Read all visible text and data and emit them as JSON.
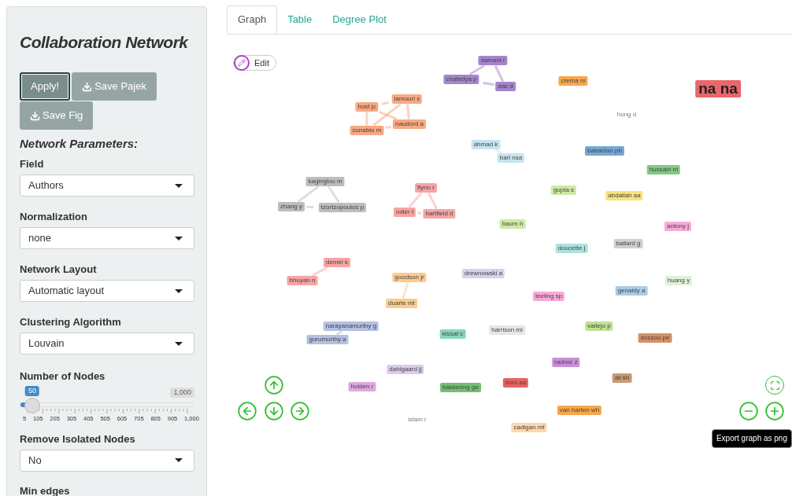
{
  "sidebar": {
    "title": "Collaboration Network",
    "buttons": [
      {
        "label": "Apply!",
        "kind": "primary"
      },
      {
        "label": "Save Pajek",
        "kind": "download"
      },
      {
        "label": "Save Fig",
        "kind": "download"
      }
    ],
    "section_title": "Network Parameters:",
    "controls": [
      {
        "kind": "select",
        "label": "Field",
        "value": "Authors"
      },
      {
        "kind": "select",
        "label": "Normalization",
        "value": "none"
      },
      {
        "kind": "select",
        "label": "Network Layout",
        "value": "Automatic layout"
      },
      {
        "kind": "select",
        "label": "Clustering Algorithm",
        "value": "Louvain"
      },
      {
        "kind": "slider",
        "label": "Number of Nodes",
        "value": "50",
        "max": "1,000",
        "level": 0.045,
        "ticks": [
          "5",
          "105",
          "205",
          "305",
          "405",
          "505",
          "605",
          "705",
          "805",
          "905",
          "1,000"
        ]
      },
      {
        "kind": "select",
        "label": "Remove Isolated Nodes",
        "value": "No"
      },
      {
        "kind": "heading",
        "label": "Min edges"
      }
    ]
  },
  "tabs": [
    {
      "label": "Graph",
      "selected": true
    },
    {
      "label": "Table",
      "selected": false
    },
    {
      "label": "Degree Plot",
      "selected": false
    }
  ],
  "graph": {
    "edit_button": "Edit",
    "tooltip": "Export graph as png",
    "nodes": [
      {
        "label": "damani r",
        "color": "#a585cc",
        "kind": "node"
      },
      {
        "label": "chattefya p",
        "color": "#a585cc",
        "kind": "node"
      },
      {
        "label": "das d",
        "color": "#a585cc",
        "kind": "node"
      },
      {
        "label": "crema m",
        "color": "#f9a64a",
        "kind": "node"
      },
      {
        "label": "na na",
        "color": "#e8676b",
        "kind": "large"
      },
      {
        "label": "hust jc",
        "color": "#f9a882",
        "kind": "node"
      },
      {
        "label": "lamouri s",
        "color": "#f9a882",
        "kind": "node"
      },
      {
        "label": "cunabio m",
        "color": "#f9a882",
        "kind": "node"
      },
      {
        "label": "naudord a",
        "color": "#f9a882",
        "kind": "node"
      },
      {
        "label": "hung d",
        "kind": "plain"
      },
      {
        "label": "ahmad k",
        "color": "#c6e3f0",
        "kind": "node"
      },
      {
        "label": "bari nsa",
        "color": "#c6e3f0",
        "kind": "node"
      },
      {
        "label": "babaldan pb",
        "color": "#74a9d6",
        "kind": "node"
      },
      {
        "label": "hussain m",
        "color": "#83c983",
        "kind": "node"
      },
      {
        "label": "kaginglou m",
        "color": "#bdbdbd",
        "kind": "node"
      },
      {
        "label": "zhang y",
        "color": "#bdbdbd",
        "kind": "node"
      },
      {
        "label": "tzortzopoulos p",
        "color": "#bdbdbd",
        "kind": "node"
      },
      {
        "label": "flynn r",
        "color": "#f7a4a4",
        "kind": "node"
      },
      {
        "label": "roller t",
        "color": "#f7a4a4",
        "kind": "node"
      },
      {
        "label": "hartfield d",
        "color": "#f7a4a4",
        "kind": "node"
      },
      {
        "label": "gupta s",
        "color": "#cdeaa4",
        "kind": "node"
      },
      {
        "label": "abdallah aa",
        "color": "#f8e27a",
        "kind": "node"
      },
      {
        "label": "baum h",
        "color": "#cdeaa4",
        "kind": "node"
      },
      {
        "label": "antony j",
        "color": "#f7aad8",
        "kind": "node"
      },
      {
        "label": "doucette j",
        "color": "#ade2dc",
        "kind": "node"
      },
      {
        "label": "ballard g",
        "color": "#cfcfcf",
        "kind": "node"
      },
      {
        "label": "demiri k",
        "color": "#f7a4a4",
        "kind": "node"
      },
      {
        "label": "bhuyan n",
        "color": "#f7a4a4",
        "kind": "node"
      },
      {
        "label": "goodson jr",
        "color": "#fccb8e",
        "kind": "node"
      },
      {
        "label": "drewnowski a",
        "color": "#d7d0ec",
        "kind": "node"
      },
      {
        "label": "huang y",
        "color": "#def2d8",
        "kind": "node"
      },
      {
        "label": "genaidy a",
        "color": "#a9cce8",
        "kind": "node"
      },
      {
        "label": "teeling sp",
        "color": "#f7aad8",
        "kind": "node"
      },
      {
        "label": "duarte mt",
        "color": "#fccb8e",
        "kind": "node"
      },
      {
        "label": "narayanamurthy g",
        "color": "#b4c0e2",
        "kind": "node"
      },
      {
        "label": "gurumurthy a",
        "color": "#b4c0e2",
        "kind": "node"
      },
      {
        "label": "kissat c",
        "color": "#85d8b6",
        "kind": "node"
      },
      {
        "label": "harrison mi",
        "color": "#e6e6e6",
        "kind": "node"
      },
      {
        "label": "vallejo p",
        "color": "#bde392",
        "kind": "node"
      },
      {
        "label": "dossou pe",
        "color": "#d69068",
        "kind": "node"
      },
      {
        "label": "radnor z",
        "color": "#c890d8",
        "kind": "node"
      },
      {
        "label": "dahlgaard jj",
        "color": "#dccbea",
        "kind": "node"
      },
      {
        "label": "ali kh",
        "color": "#c99a72",
        "kind": "node"
      },
      {
        "label": "holden r",
        "color": "#dcaae2",
        "kind": "node"
      },
      {
        "label": "bakkering ge",
        "color": "#72c072",
        "kind": "node"
      },
      {
        "label": "boni aa",
        "color": "#e86262",
        "kind": "node"
      },
      {
        "label": "van harten wh",
        "color": "#f9a64a",
        "kind": "node"
      },
      {
        "label": "islam r",
        "kind": "plain"
      },
      {
        "label": "cadigan mf",
        "color": "#fcd8aa",
        "kind": "node"
      }
    ]
  }
}
